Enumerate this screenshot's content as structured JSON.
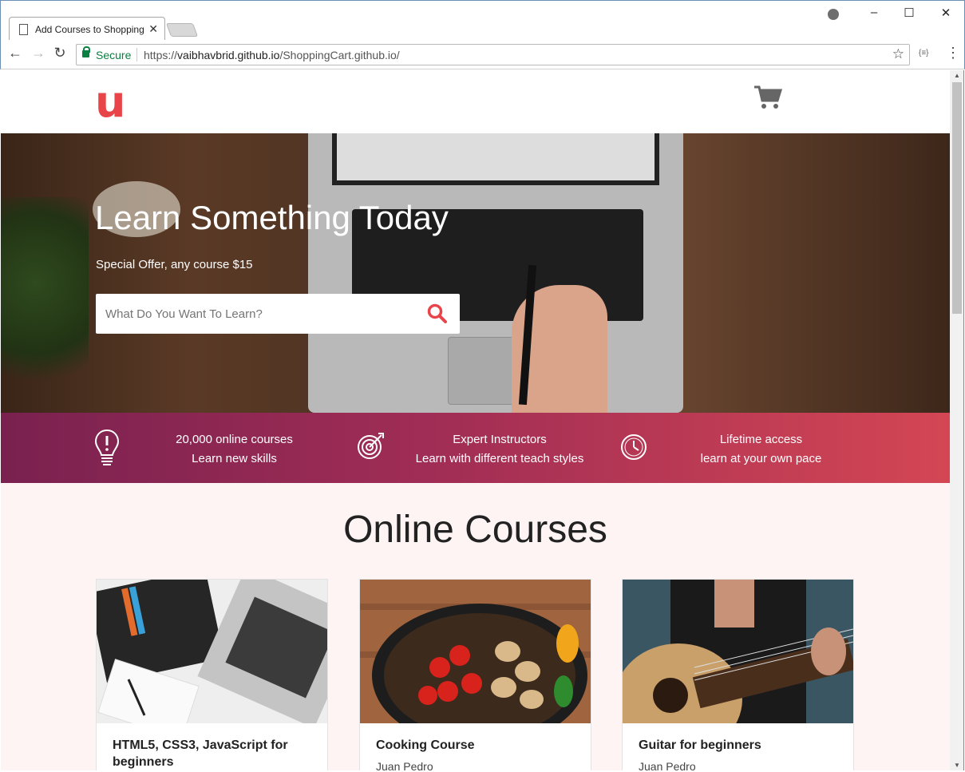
{
  "browser": {
    "tab_title": "Add Courses to Shopping",
    "secure_label": "Secure",
    "url_scheme": "https://",
    "url_host": "vaibhavbrid.github.io",
    "url_path": "/ShoppingCart.github.io/"
  },
  "site": {
    "logo": "u",
    "hero_title": "Learn Something Today",
    "hero_subtitle": "Special Offer, any course $15",
    "search_placeholder": "What Do You Want To Learn?"
  },
  "features": [
    {
      "line1": "20,000 online courses",
      "line2": "Learn new skills",
      "icon": "lightbulb-icon"
    },
    {
      "line1": "Expert Instructors",
      "line2": "Learn with different teach styles",
      "icon": "target-icon"
    },
    {
      "line1": "Lifetime access",
      "line2": "learn at your own pace",
      "icon": "clock-icon"
    }
  ],
  "section_title": "Online Courses",
  "courses": [
    {
      "title": "HTML5, CSS3, JavaScript for beginners",
      "author": "",
      "image": "laptop-notebook"
    },
    {
      "title": "Cooking Course",
      "author": "Juan Pedro",
      "image": "vegetables-pot"
    },
    {
      "title": "Guitar for beginners",
      "author": "Juan Pedro",
      "image": "guitar-player"
    }
  ],
  "colors": {
    "brand": "#e8454a",
    "feature_gradient_start": "#7a2150",
    "feature_gradient_end": "#d44654",
    "secure_green": "#0b8043"
  }
}
